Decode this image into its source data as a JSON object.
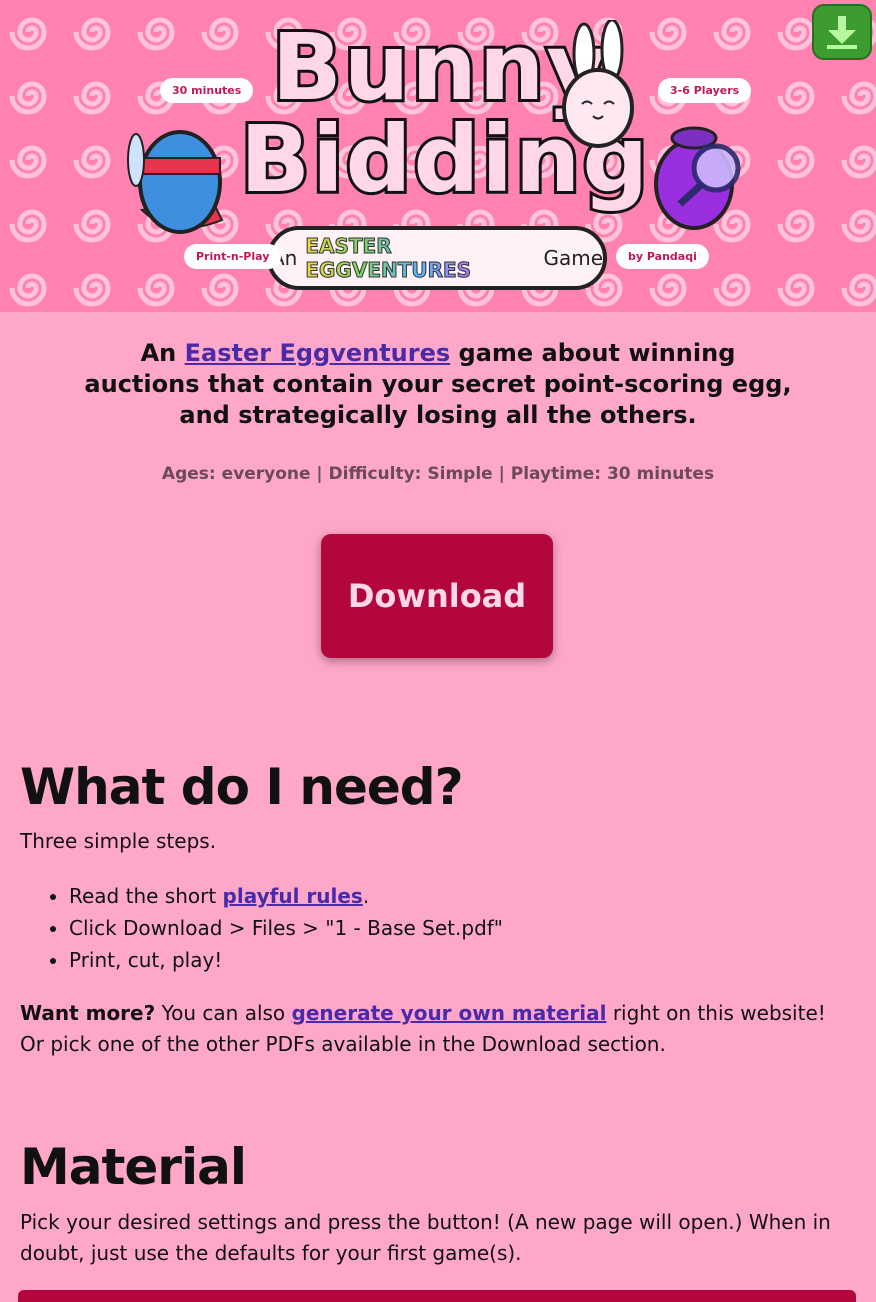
{
  "header": {
    "title_line1": "Bunny",
    "title_line2": "Bidding",
    "subtitle_prefix": "An",
    "subtitle_brand": "EASTER EGGVENTURES",
    "subtitle_suffix": "Game",
    "sticker_time": "30 minutes",
    "sticker_players": "3-6 Players",
    "sticker_print": "Print-n-Play",
    "sticker_author": "by Pandaqi"
  },
  "intro": {
    "prefix": "An",
    "link": "Easter Eggventures",
    "rest": "game about winning auctions that contain your secret point-scoring egg, and strategically losing all the others."
  },
  "meta": "Ages: everyone | Difficulty: Simple | Playtime: 30 minutes",
  "download_label": "Download",
  "need": {
    "heading": "What do I need?",
    "subtitle": "Three simple steps.",
    "step1_prefix": "Read the short",
    "step1_link": "playful rules",
    "step1_suffix": ".",
    "step2": "Click Download > Files > \"1 - Base Set.pdf\"",
    "step3": "Print, cut, play!",
    "more_label": "Want more?",
    "more_prefix": "You can also",
    "more_link": "generate your own material",
    "more_suffix": "right on this website! Or pick one of the other PDFs available in the Download section."
  },
  "material": {
    "heading": "Material",
    "text": "Pick your desired settings and press the button! (A new page will open.) When in doubt, just use the defaults for your first game(s)."
  },
  "colors": {
    "background": "#ffa7c9",
    "accent": "#b3063c",
    "link": "#4b2aa8"
  }
}
